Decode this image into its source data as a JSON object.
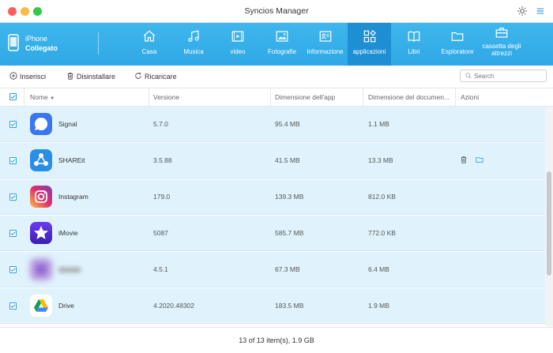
{
  "window": {
    "title": "Syncios Manager"
  },
  "device": {
    "name": "iPhone",
    "status": "Collegato"
  },
  "nav": [
    {
      "label": "Casa",
      "icon": "home-icon"
    },
    {
      "label": "Musica",
      "icon": "music-icon"
    },
    {
      "label": "video",
      "icon": "video-icon"
    },
    {
      "label": "Fotografie",
      "icon": "photo-icon"
    },
    {
      "label": "Informazione",
      "icon": "contact-card-icon"
    },
    {
      "label": "applicazioni",
      "icon": "apps-icon"
    },
    {
      "label": "Libri",
      "icon": "book-icon"
    },
    {
      "label": "Esploratore",
      "icon": "folder-icon"
    },
    {
      "label": "cassetta degli attrezzi",
      "icon": "toolbox-icon"
    }
  ],
  "actions": {
    "install": "Inserisci",
    "uninstall": "Disinstallare",
    "reload": "Ricaricare"
  },
  "search": {
    "placeholder": "Search"
  },
  "table": {
    "headers": {
      "name": "Nome",
      "version": "Versione",
      "app_size": "Dimensione dell'app",
      "doc_size": "Dimensione del documen...",
      "actions": "Azioni"
    },
    "rows": [
      {
        "name": "Signal",
        "version": "5.7.0",
        "app_size": "95.4 MB",
        "doc_size": "1.1 MB",
        "icon": "signal-icon"
      },
      {
        "name": "SHAREit",
        "version": "3.5.88",
        "app_size": "41.5 MB",
        "doc_size": "13.3 MB",
        "icon": "shareit-icon"
      },
      {
        "name": "Instagram",
        "version": "179.0",
        "app_size": "139.3 MB",
        "doc_size": "812.0 KB",
        "icon": "instagram-icon"
      },
      {
        "name": "iMovie",
        "version": "5087",
        "app_size": "585.7 MB",
        "doc_size": "772.0 KB",
        "icon": "imovie-icon"
      },
      {
        "name": "",
        "version": "4.5.1",
        "app_size": "67.3 MB",
        "doc_size": "6.4 MB",
        "icon": "blurred-app-icon"
      },
      {
        "name": "Drive",
        "version": "4.2020.48302",
        "app_size": "183.5 MB",
        "doc_size": "1.9 MB",
        "icon": "google-drive-icon"
      }
    ]
  },
  "footer": {
    "summary": "13 of 13 item(s), 1.9 GB"
  },
  "colors": {
    "toolbar": "#36aeea",
    "active_tab": "#1e8fd3",
    "row_bg": "#e0f3fc",
    "checkbox": "#2fa0e0"
  }
}
